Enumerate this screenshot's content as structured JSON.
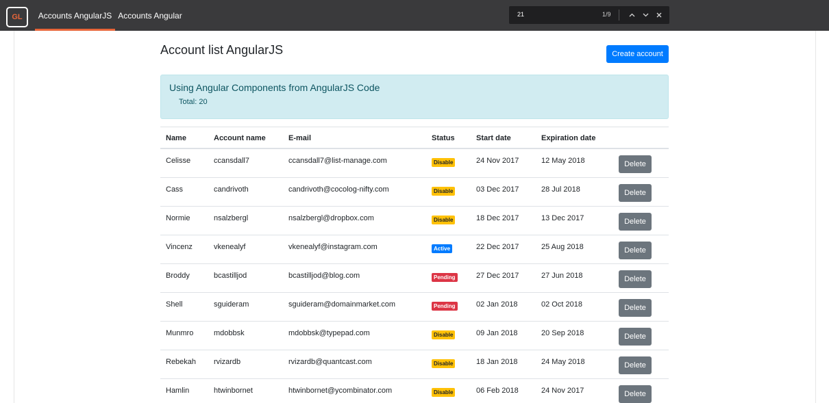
{
  "nav": {
    "logo": "GL",
    "tabs": [
      {
        "label": "Accounts AngularJS",
        "active": true
      },
      {
        "label": "Accounts Angular",
        "active": false
      }
    ],
    "accent_color": "#e8663a"
  },
  "findbar": {
    "query": "21",
    "match_count": "1/9",
    "prev_icon": "chevron-up-icon",
    "next_icon": "chevron-down-icon",
    "close_icon": "close-icon"
  },
  "page": {
    "title": "Account list AngularJS",
    "create_label": "Create account"
  },
  "alert": {
    "title": "Using Angular Components from AngularJS Code",
    "total": "Total: 20"
  },
  "table": {
    "headers": {
      "name": "Name",
      "account": "Account name",
      "email": "E-mail",
      "status": "Status",
      "start": "Start date",
      "expiration": "Expiration date"
    },
    "delete_label": "Delete",
    "status_colors": {
      "Disable": "#ffc107",
      "Active": "#007bff",
      "Pending": "#dc3545"
    },
    "rows": [
      {
        "name": "Celisse",
        "account": "ccansdall7",
        "email": "ccansdall7@list-manage.com",
        "status": "Disable",
        "start": "24 Nov 2017",
        "expiration": "12 May 2018"
      },
      {
        "name": "Cass",
        "account": "candrivoth",
        "email": "candrivoth@cocolog-nifty.com",
        "status": "Disable",
        "start": "03 Dec 2017",
        "expiration": "28 Jul 2018"
      },
      {
        "name": "Normie",
        "account": "nsalzbergl",
        "email": "nsalzbergl@dropbox.com",
        "status": "Disable",
        "start": "18 Dec 2017",
        "expiration": "13 Dec 2017"
      },
      {
        "name": "Vincenz",
        "account": "vkenealyf",
        "email": "vkenealyf@instagram.com",
        "status": "Active",
        "start": "22 Dec 2017",
        "expiration": "25 Aug 2018"
      },
      {
        "name": "Broddy",
        "account": "bcastilljod",
        "email": "bcastilljod@blog.com",
        "status": "Pending",
        "start": "27 Dec 2017",
        "expiration": "27 Jun 2018"
      },
      {
        "name": "Shell",
        "account": "sguideram",
        "email": "sguideram@domainmarket.com",
        "status": "Pending",
        "start": "02 Jan 2018",
        "expiration": "02 Oct 2018"
      },
      {
        "name": "Munmro",
        "account": "mdobbsk",
        "email": "mdobbsk@typepad.com",
        "status": "Disable",
        "start": "09 Jan 2018",
        "expiration": "20 Sep 2018"
      },
      {
        "name": "Rebekah",
        "account": "rvizardb",
        "email": "rvizardb@quantcast.com",
        "status": "Disable",
        "start": "18 Jan 2018",
        "expiration": "24 May 2018"
      },
      {
        "name": "Hamlin",
        "account": "htwinbornet",
        "email": "htwinbornet@ycombinator.com",
        "status": "Disable",
        "start": "06 Feb 2018",
        "expiration": "24 Nov 2017"
      }
    ]
  }
}
